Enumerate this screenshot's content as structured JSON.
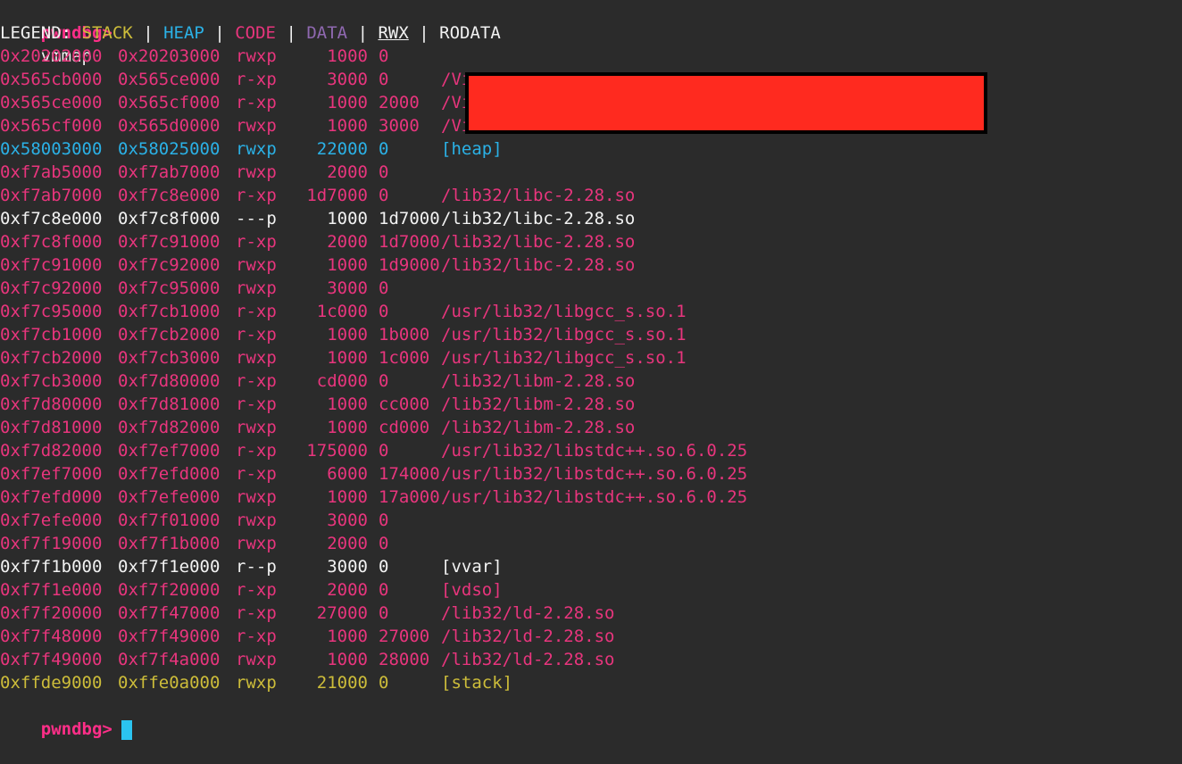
{
  "terminal": {
    "prompt": "pwndbg>",
    "command": "vmmap",
    "legend": {
      "label": "LEGEND:",
      "separator": "|",
      "stack": "STACK",
      "heap": "HEAP",
      "code": "CODE",
      "data": "DATA",
      "rwx": "RWX",
      "rodata": "RODATA"
    },
    "colors": {
      "stack": "#cdbd3a",
      "heap": "#2bb1e6",
      "code": "#e8357d",
      "data": "#8f68b0",
      "rwx": "#f2f2f2",
      "rodata": "#f2f2f2",
      "prompt": "#ff2e88",
      "redaction": "#ff2a1f",
      "cursor": "#2bc4f0"
    },
    "rows": [
      {
        "start": "0x20202000",
        "end": "0x20203000",
        "perm": "rwxp",
        "size": "1000",
        "offset": "0",
        "path": "",
        "type": "code",
        "rwx": true
      },
      {
        "start": "0x565cb000",
        "end": "0x565ce000",
        "perm": "r-xp",
        "size": "3000",
        "offset": "0",
        "path": "/Virtual/virtual",
        "type": "code",
        "rwx": false
      },
      {
        "start": "0x565ce000",
        "end": "0x565cf000",
        "perm": "r-xp",
        "size": "1000",
        "offset": "2000",
        "path": "/Virtual/virtual",
        "type": "code",
        "rwx": false
      },
      {
        "start": "0x565cf000",
        "end": "0x565d0000",
        "perm": "rwxp",
        "size": "1000",
        "offset": "3000",
        "path": "/Virtual/virtual",
        "type": "code",
        "rwx": true
      },
      {
        "start": "0x58003000",
        "end": "0x58025000",
        "perm": "rwxp",
        "size": "22000",
        "offset": "0",
        "path": "[heap]",
        "type": "heap",
        "rwx": true
      },
      {
        "start": "0xf7ab5000",
        "end": "0xf7ab7000",
        "perm": "rwxp",
        "size": "2000",
        "offset": "0",
        "path": "",
        "type": "code",
        "rwx": true
      },
      {
        "start": "0xf7ab7000",
        "end": "0xf7c8e000",
        "perm": "r-xp",
        "size": "1d7000",
        "offset": "0",
        "path": "/lib32/libc-2.28.so",
        "type": "code",
        "rwx": false
      },
      {
        "start": "0xf7c8e000",
        "end": "0xf7c8f000",
        "perm": "---p",
        "size": "1000",
        "offset": "1d7000",
        "path": "/lib32/libc-2.28.so",
        "type": "rodata",
        "rwx": false
      },
      {
        "start": "0xf7c8f000",
        "end": "0xf7c91000",
        "perm": "r-xp",
        "size": "2000",
        "offset": "1d7000",
        "path": "/lib32/libc-2.28.so",
        "type": "code",
        "rwx": false
      },
      {
        "start": "0xf7c91000",
        "end": "0xf7c92000",
        "perm": "rwxp",
        "size": "1000",
        "offset": "1d9000",
        "path": "/lib32/libc-2.28.so",
        "type": "code",
        "rwx": true
      },
      {
        "start": "0xf7c92000",
        "end": "0xf7c95000",
        "perm": "rwxp",
        "size": "3000",
        "offset": "0",
        "path": "",
        "type": "code",
        "rwx": true
      },
      {
        "start": "0xf7c95000",
        "end": "0xf7cb1000",
        "perm": "r-xp",
        "size": "1c000",
        "offset": "0",
        "path": "/usr/lib32/libgcc_s.so.1",
        "type": "code",
        "rwx": false
      },
      {
        "start": "0xf7cb1000",
        "end": "0xf7cb2000",
        "perm": "r-xp",
        "size": "1000",
        "offset": "1b000",
        "path": "/usr/lib32/libgcc_s.so.1",
        "type": "code",
        "rwx": false
      },
      {
        "start": "0xf7cb2000",
        "end": "0xf7cb3000",
        "perm": "rwxp",
        "size": "1000",
        "offset": "1c000",
        "path": "/usr/lib32/libgcc_s.so.1",
        "type": "code",
        "rwx": true
      },
      {
        "start": "0xf7cb3000",
        "end": "0xf7d80000",
        "perm": "r-xp",
        "size": "cd000",
        "offset": "0",
        "path": "/lib32/libm-2.28.so",
        "type": "code",
        "rwx": false
      },
      {
        "start": "0xf7d80000",
        "end": "0xf7d81000",
        "perm": "r-xp",
        "size": "1000",
        "offset": "cc000",
        "path": "/lib32/libm-2.28.so",
        "type": "code",
        "rwx": false
      },
      {
        "start": "0xf7d81000",
        "end": "0xf7d82000",
        "perm": "rwxp",
        "size": "1000",
        "offset": "cd000",
        "path": "/lib32/libm-2.28.so",
        "type": "code",
        "rwx": true
      },
      {
        "start": "0xf7d82000",
        "end": "0xf7ef7000",
        "perm": "r-xp",
        "size": "175000",
        "offset": "0",
        "path": "/usr/lib32/libstdc++.so.6.0.25",
        "type": "code",
        "rwx": false
      },
      {
        "start": "0xf7ef7000",
        "end": "0xf7efd000",
        "perm": "r-xp",
        "size": "6000",
        "offset": "174000",
        "path": "/usr/lib32/libstdc++.so.6.0.25",
        "type": "code",
        "rwx": false
      },
      {
        "start": "0xf7efd000",
        "end": "0xf7efe000",
        "perm": "rwxp",
        "size": "1000",
        "offset": "17a000",
        "path": "/usr/lib32/libstdc++.so.6.0.25",
        "type": "code",
        "rwx": true
      },
      {
        "start": "0xf7efe000",
        "end": "0xf7f01000",
        "perm": "rwxp",
        "size": "3000",
        "offset": "0",
        "path": "",
        "type": "code",
        "rwx": true
      },
      {
        "start": "0xf7f19000",
        "end": "0xf7f1b000",
        "perm": "rwxp",
        "size": "2000",
        "offset": "0",
        "path": "",
        "type": "code",
        "rwx": true
      },
      {
        "start": "0xf7f1b000",
        "end": "0xf7f1e000",
        "perm": "r--p",
        "size": "3000",
        "offset": "0",
        "path": "[vvar]",
        "type": "rodata",
        "rwx": false
      },
      {
        "start": "0xf7f1e000",
        "end": "0xf7f20000",
        "perm": "r-xp",
        "size": "2000",
        "offset": "0",
        "path": "[vdso]",
        "type": "code",
        "rwx": false
      },
      {
        "start": "0xf7f20000",
        "end": "0xf7f47000",
        "perm": "r-xp",
        "size": "27000",
        "offset": "0",
        "path": "/lib32/ld-2.28.so",
        "type": "code",
        "rwx": false
      },
      {
        "start": "0xf7f48000",
        "end": "0xf7f49000",
        "perm": "r-xp",
        "size": "1000",
        "offset": "27000",
        "path": "/lib32/ld-2.28.so",
        "type": "code",
        "rwx": false
      },
      {
        "start": "0xf7f49000",
        "end": "0xf7f4a000",
        "perm": "rwxp",
        "size": "1000",
        "offset": "28000",
        "path": "/lib32/ld-2.28.so",
        "type": "code",
        "rwx": true
      },
      {
        "start": "0xffde9000",
        "end": "0xffe0a000",
        "perm": "rwxp",
        "size": "21000",
        "offset": "0",
        "path": "[stack]",
        "type": "stack",
        "rwx": true
      }
    ]
  }
}
